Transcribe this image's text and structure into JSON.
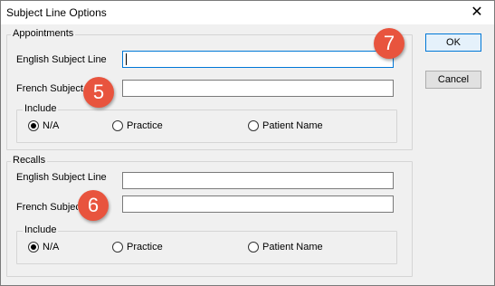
{
  "window": {
    "title": "Subject Line Options",
    "close_symbol": "✕"
  },
  "appointments": {
    "group_label": "Appointments",
    "english_label": "English Subject Line",
    "english_value": "",
    "french_label": "French Subject Line",
    "french_value": "",
    "include": {
      "label": "Include",
      "options": [
        "N/A",
        "Practice",
        "Patient Name"
      ],
      "selected": "N/A"
    }
  },
  "recalls": {
    "group_label": "Recalls",
    "english_label": "English Subject Line",
    "english_value": "",
    "french_label": "French Subject Line",
    "french_value": "",
    "include": {
      "label": "Include",
      "options": [
        "N/A",
        "Practice",
        "Patient Name"
      ],
      "selected": "N/A"
    }
  },
  "buttons": {
    "ok": "OK",
    "cancel": "Cancel"
  },
  "callouts": {
    "french_appointments": "5",
    "french_recalls": "6",
    "ok": "7"
  },
  "colors": {
    "callout": "#e8543e",
    "focus_border": "#0078d7"
  }
}
